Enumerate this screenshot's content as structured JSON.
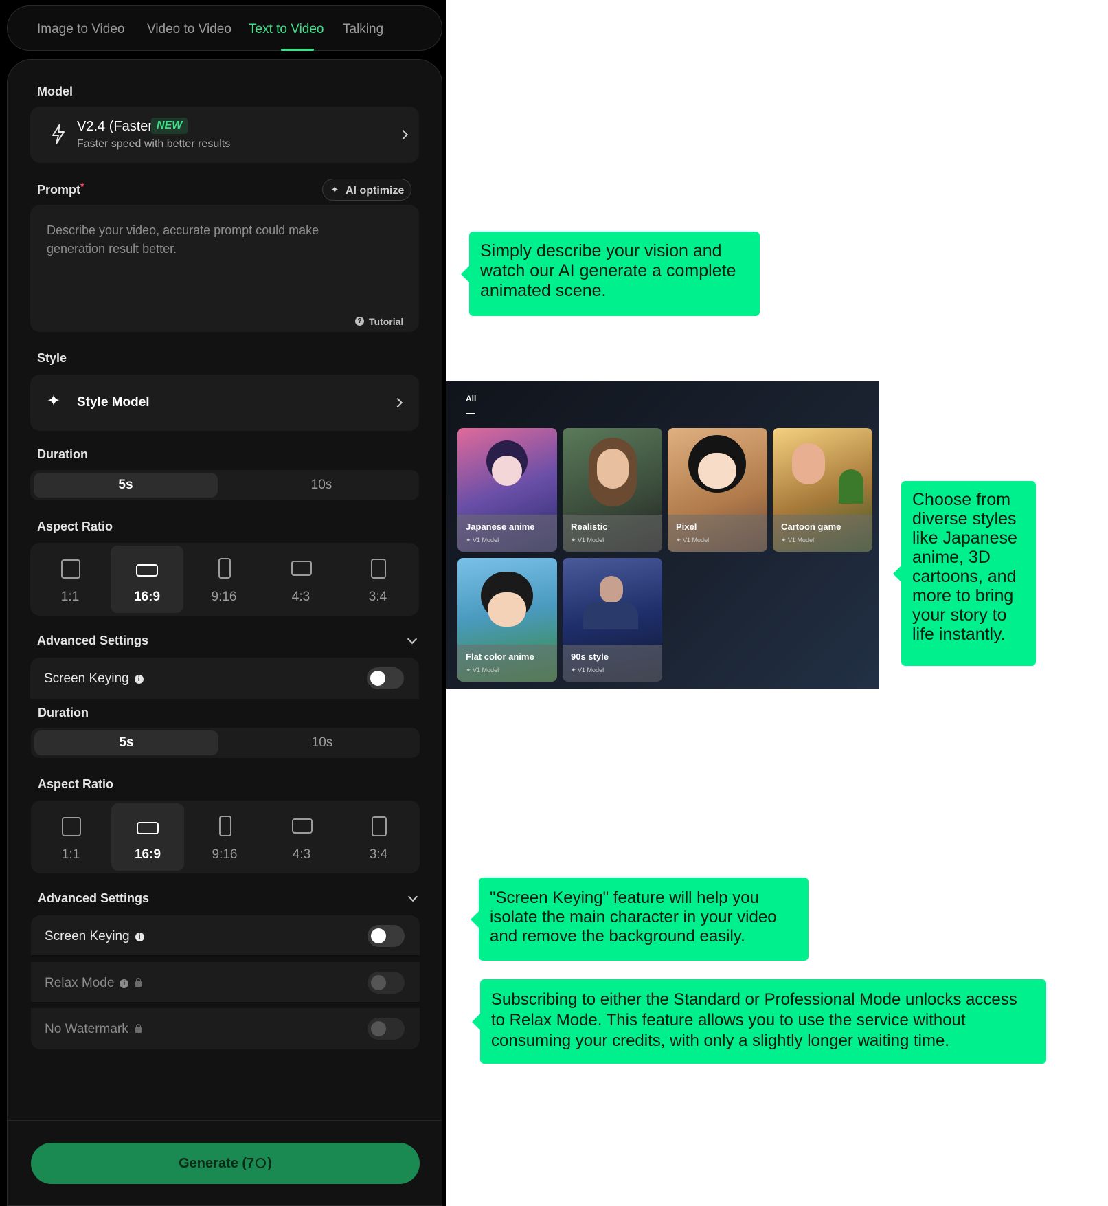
{
  "tabs": [
    "Image to Video",
    "Video to Video",
    "Text to Video",
    "Talking"
  ],
  "active_tab": "Text to Video",
  "model": {
    "label": "Model",
    "name": "V2.4 (Faster)",
    "badge": "NEW",
    "description": "Faster speed with better results"
  },
  "prompt": {
    "label": "Prompt",
    "required_mark": "*",
    "ai_optimize": "AI optimize",
    "placeholder": "Describe your video, accurate prompt could make generation result better.",
    "tutorial": "Tutorial"
  },
  "style": {
    "label": "Style",
    "value": "Style Model"
  },
  "duration": {
    "label": "Duration",
    "options": [
      "5s",
      "10s"
    ],
    "selected": "5s"
  },
  "aspect_ratio": {
    "label": "Aspect Ratio",
    "options": [
      "1:1",
      "16:9",
      "9:16",
      "4:3",
      "3:4"
    ],
    "selected": "16:9"
  },
  "advanced": {
    "label": "Advanced Settings"
  },
  "toggles": {
    "screen_keying": "Screen Keying",
    "relax_mode": "Relax Mode",
    "no_watermark": "No Watermark"
  },
  "generate": {
    "label": "Generate (7",
    "suffix": ")"
  },
  "callouts": {
    "prompt": "Simply describe your vision and watch our AI generate a complete animated scene.",
    "styles": "Choose from diverse styles like Japanese anime, 3D cartoons, and more to bring your story to life instantly.",
    "keying": "\"Screen Keying\" feature will help you isolate the main character in your video and remove the background easily.",
    "relax": "Subscribing to either the Standard or Professional Mode unlocks access to Relax Mode. This feature allows you to use the service without consuming your credits, with only a slightly longer waiting time."
  },
  "gallery": {
    "tab": "All",
    "model_tag": "V1 Model",
    "styles": [
      {
        "name": "Japanese anime",
        "color": "#6a4fa8"
      },
      {
        "name": "Realistic",
        "color": "#3a4a3a"
      },
      {
        "name": "Pixel",
        "color": "#b07a4a"
      },
      {
        "name": "Cartoon game",
        "color": "#a77a3a"
      },
      {
        "name": "Flat color anime",
        "color": "#4a9ac0"
      },
      {
        "name": "90s style",
        "color": "#1e2e6a"
      }
    ]
  },
  "colors": {
    "accent": "#3ee08a",
    "callout": "#00f08e",
    "generate": "#1a8a52"
  }
}
